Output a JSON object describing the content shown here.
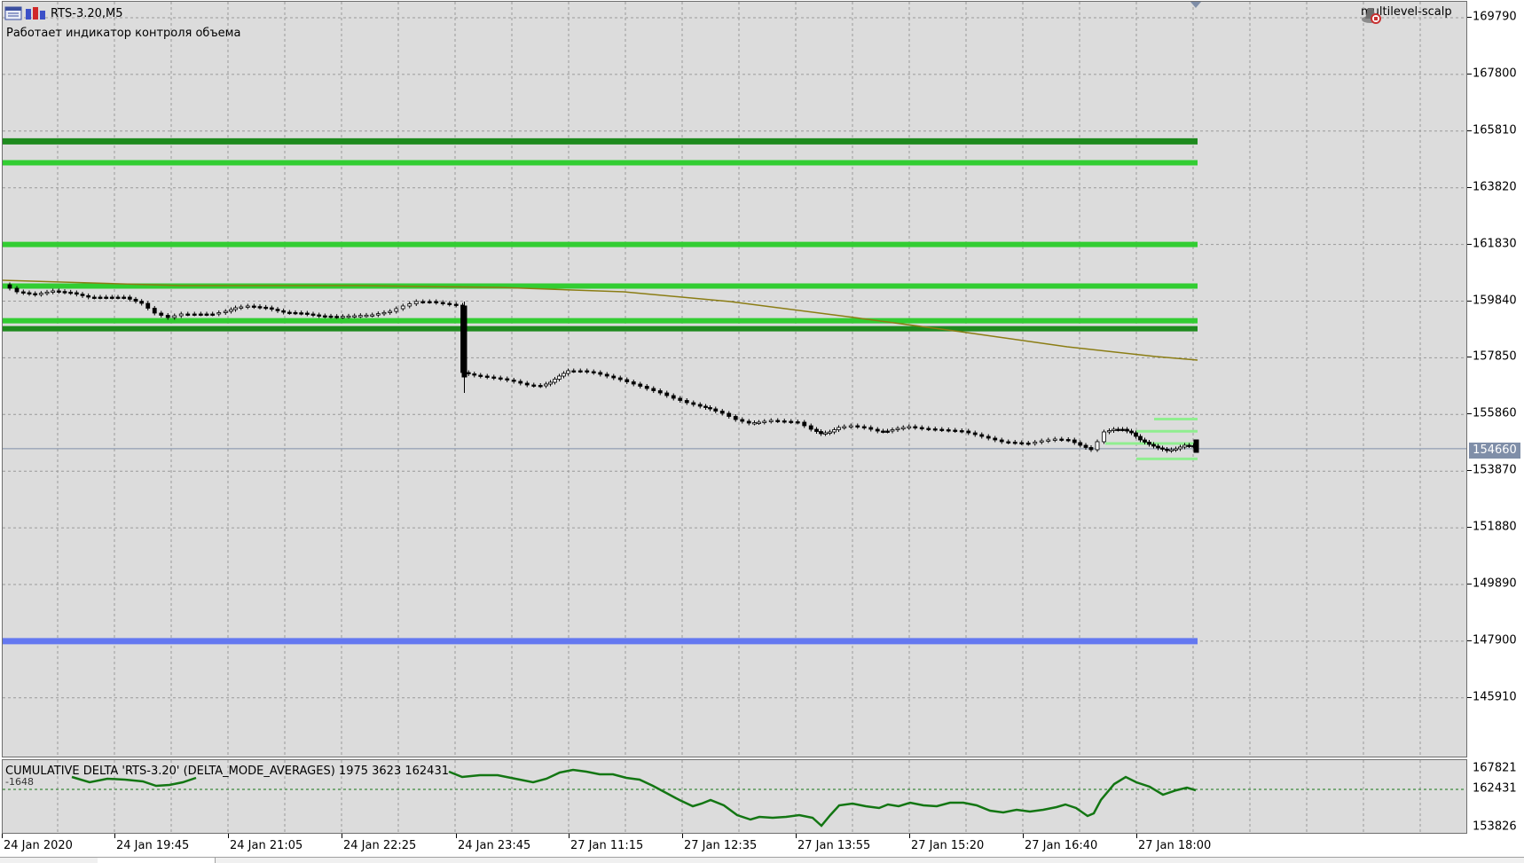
{
  "header": {
    "symbol": "RTS-3.20,M5",
    "status_text": "Работает индикатор контроля объема",
    "expert_name": "multilevel-scalp"
  },
  "price_axis": {
    "labels": [
      "169790",
      "167800",
      "165810",
      "163820",
      "161830",
      "159840",
      "157850",
      "155860",
      "153870",
      "151880",
      "149890",
      "147900",
      "145910"
    ],
    "current_price": "154660"
  },
  "sub_window": {
    "title": "CUMULATIVE DELTA 'RTS-3.20' (DELTA_MODE_AVERAGES) 1975 3623 162431",
    "value_text": "-1648",
    "axis_labels": [
      "167821",
      "162431",
      "153826"
    ]
  },
  "time_axis": {
    "labels": [
      "24 Jan 2020",
      "24 Jan 19:45",
      "24 Jan 21:05",
      "24 Jan 22:25",
      "24 Jan 23:45",
      "27 Jan 11:15",
      "27 Jan 12:35",
      "27 Jan 13:55",
      "27 Jan 15:20",
      "27 Jan 16:40",
      "27 Jan 18:00"
    ]
  },
  "colors": {
    "chart_background": "#dcdcdc",
    "grid": "#9a9a9a",
    "level_dark_green": "#1e8a1e",
    "level_green": "#32cd32",
    "level_blue": "#6478f0",
    "moving_average": "#8b7d14",
    "delta_line": "#137613",
    "price_tag": "#7f8ea8"
  },
  "icons": {
    "chart_icon": "chart-window-icon",
    "bars_icon": "bars-icon",
    "expert_icon": "expert-hat-icon"
  }
}
